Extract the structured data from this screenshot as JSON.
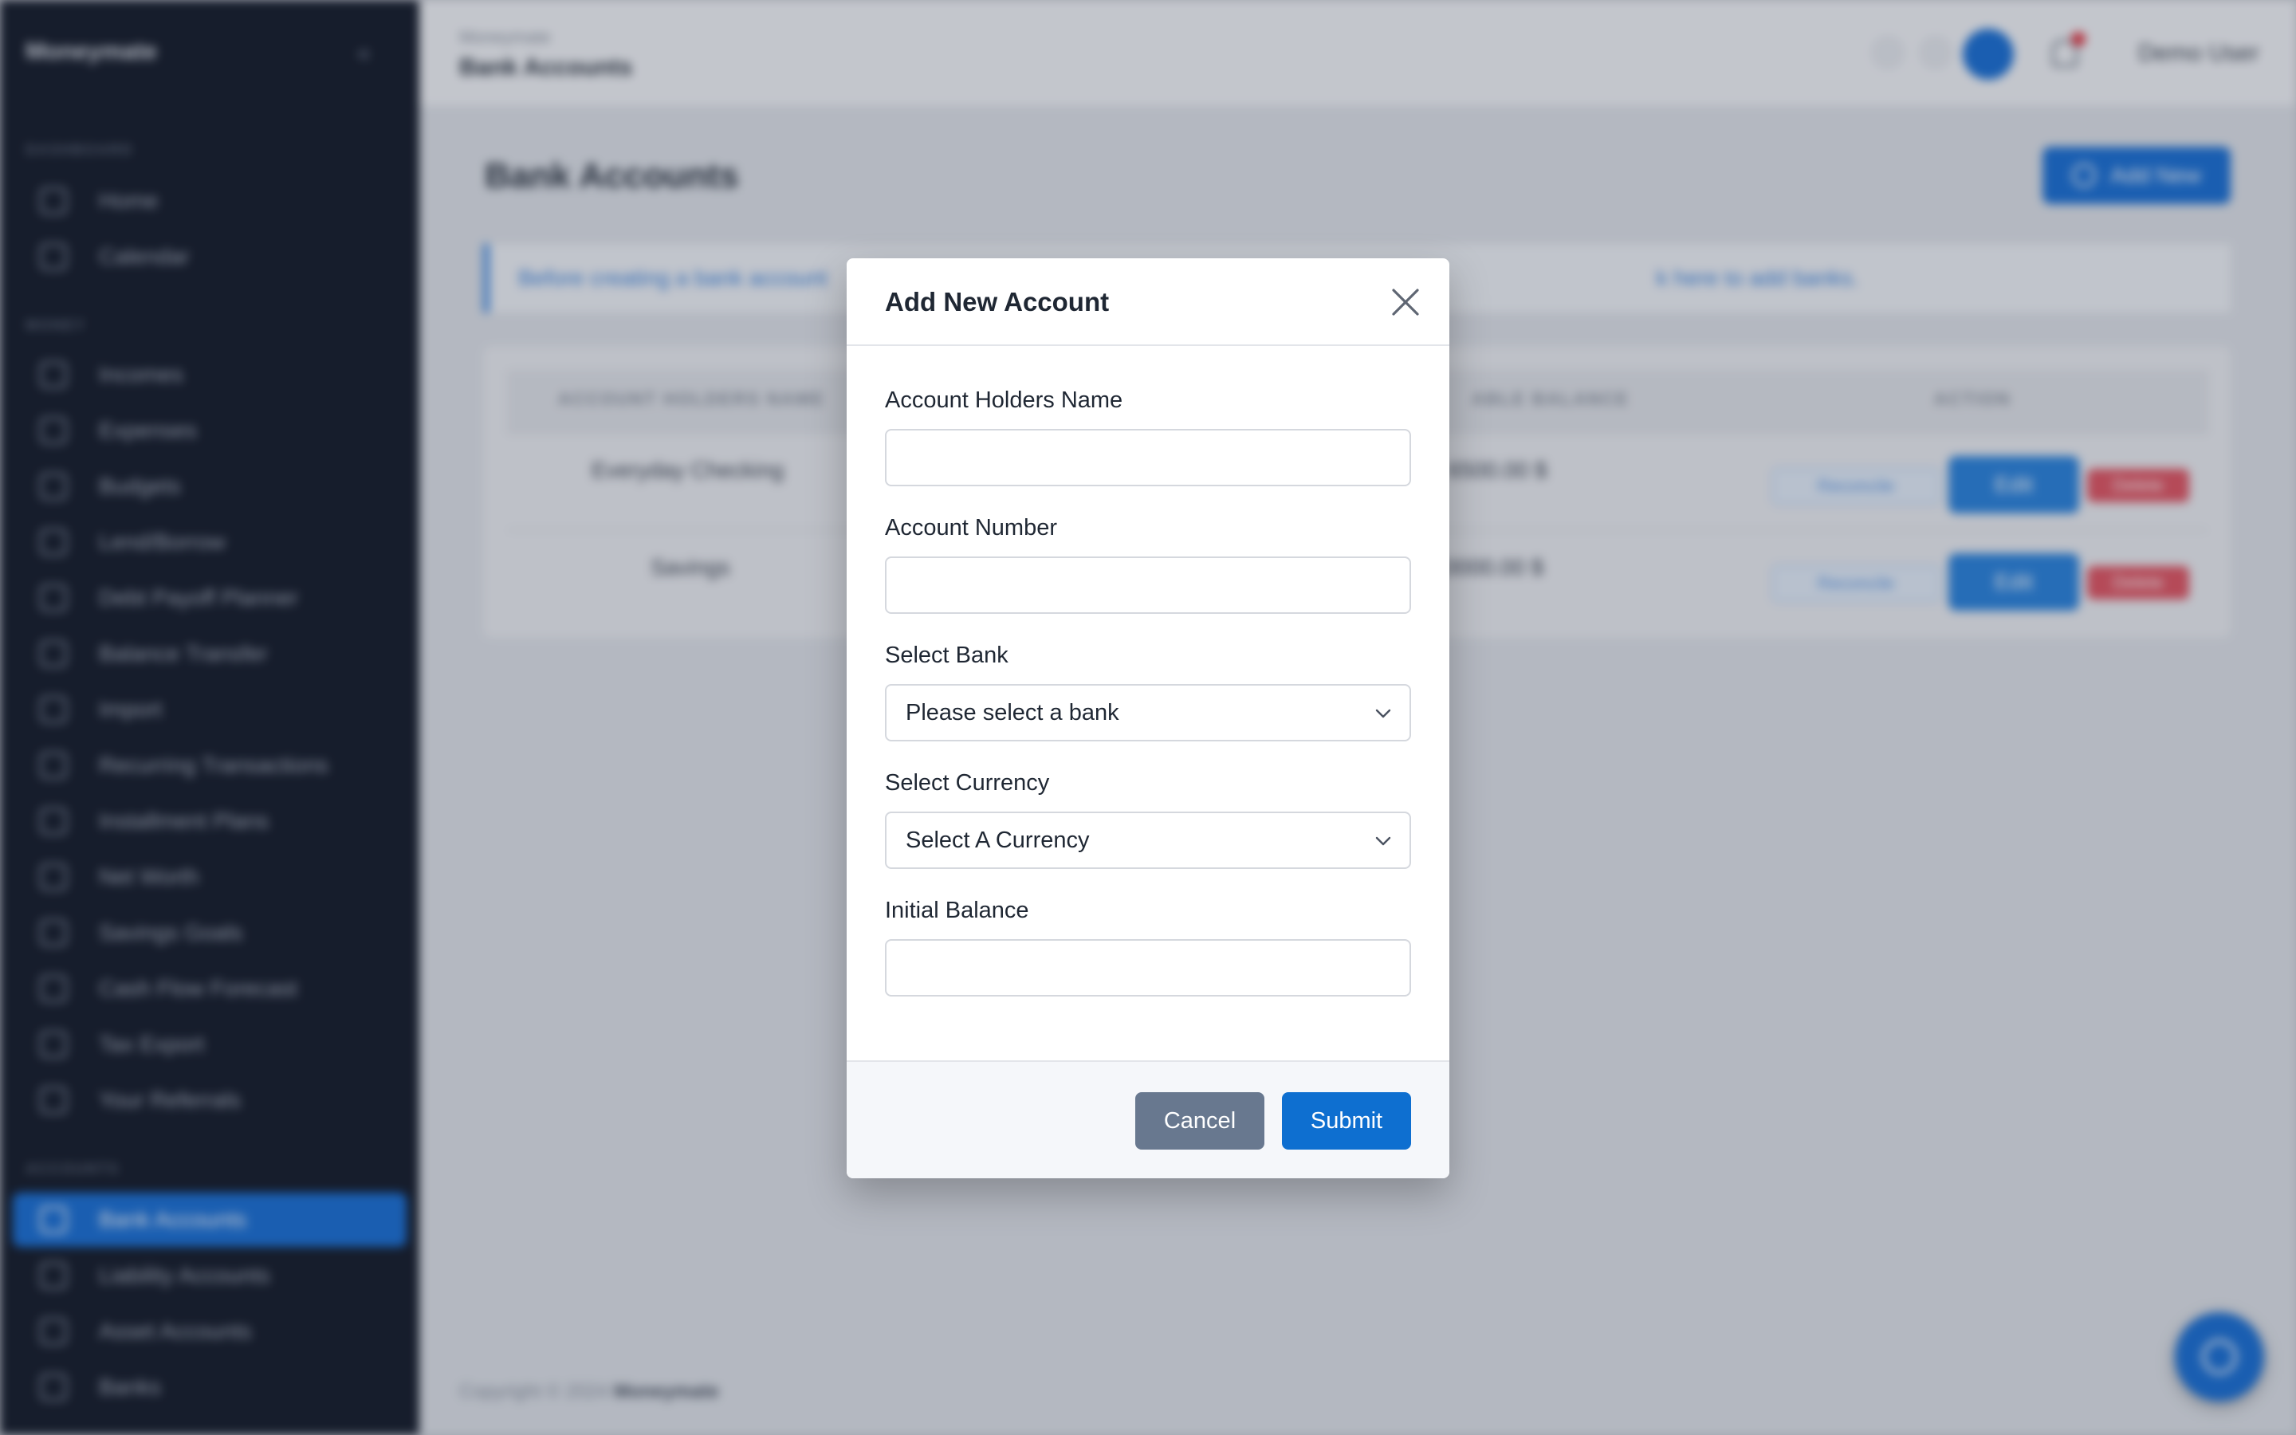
{
  "app": {
    "brand": "Moneymate",
    "breadcrumb_small": "Moneymate",
    "breadcrumb_page": "Bank Accounts",
    "user_name": "Demo User",
    "page_title": "Bank Accounts",
    "add_new_label": "Add New",
    "alert_text_start": "Before creating a bank account",
    "alert_text_end": "k here to add banks.",
    "footer_copyright": "Copyright © 2024",
    "footer_brand": "Moneymate",
    "accent_color": "#1a6fd4"
  },
  "sidebar": {
    "sections": [
      "DASHBOARD",
      "MONEY",
      "ACCOUNTS"
    ],
    "items": [
      {
        "label": "Home",
        "icon": "home-icon"
      },
      {
        "label": "Calendar",
        "icon": "calendar-icon"
      },
      {
        "label": "Incomes",
        "icon": "income-icon"
      },
      {
        "label": "Expenses",
        "icon": "expense-icon"
      },
      {
        "label": "Budgets",
        "icon": "budget-icon"
      },
      {
        "label": "Lend/Borrow",
        "icon": "handshake-icon"
      },
      {
        "label": "Debt Payoff Planner",
        "icon": "debt-icon"
      },
      {
        "label": "Balance Transfer",
        "icon": "transfer-icon"
      },
      {
        "label": "Import",
        "icon": "import-icon"
      },
      {
        "label": "Recurring Transactions",
        "icon": "recurring-icon"
      },
      {
        "label": "Installment Plans",
        "icon": "installment-icon"
      },
      {
        "label": "Net Worth",
        "icon": "networth-icon"
      },
      {
        "label": "Savings Goals",
        "icon": "savings-icon"
      },
      {
        "label": "Cash Flow Forecast",
        "icon": "forecast-icon"
      },
      {
        "label": "Tax Export",
        "icon": "tax-icon"
      },
      {
        "label": "Your Referrals",
        "icon": "referral-icon"
      },
      {
        "label": "Bank Accounts",
        "icon": "bank-icon",
        "active": true
      },
      {
        "label": "Liability Accounts",
        "icon": "liability-icon"
      },
      {
        "label": "Asset Accounts",
        "icon": "asset-icon"
      },
      {
        "label": "Banks",
        "icon": "banks-icon"
      }
    ]
  },
  "table": {
    "headers": [
      "ACCOUNT HOLDERS NAME",
      "AVAILABLE BALANCE",
      "ACTION"
    ],
    "header_visible": [
      "ACCOUNT HOLDERS NAME",
      "ABLE BALANCE",
      "ACTION"
    ],
    "rows": [
      {
        "name": "Everyday Checking",
        "balance": "6500.00 $"
      },
      {
        "name": "Savings",
        "balance": "10000.00 $"
      }
    ],
    "actions": {
      "reconcile": "Reconcile",
      "edit": "Edit",
      "delete": "Delete"
    }
  },
  "modal": {
    "title": "Add New Account",
    "fields": {
      "holder_name": {
        "label": "Account Holders Name",
        "value": "",
        "placeholder": ""
      },
      "account_number": {
        "label": "Account Number",
        "value": "",
        "placeholder": ""
      },
      "bank": {
        "label": "Select Bank",
        "selected": "Please select a bank"
      },
      "currency": {
        "label": "Select Currency",
        "selected": "Select A Currency"
      },
      "initial_balance": {
        "label": "Initial Balance",
        "value": "",
        "placeholder": ""
      }
    },
    "cancel_label": "Cancel",
    "submit_label": "Submit",
    "submit_color": "#0e6fd0",
    "cancel_color": "#68788f"
  }
}
